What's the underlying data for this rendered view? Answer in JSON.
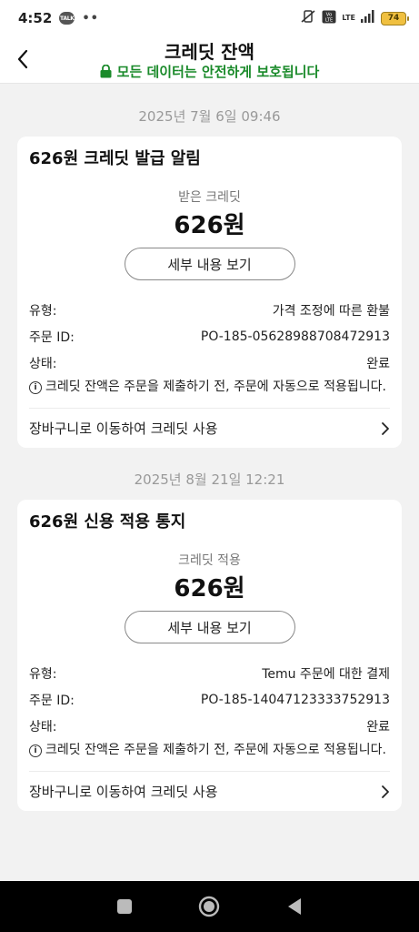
{
  "status_bar": {
    "time": "4:52",
    "talk_badge": "TALK",
    "dots": "••",
    "lte": "LTE",
    "battery": "74"
  },
  "header": {
    "title": "크레딧 잔액",
    "subtitle": "모든 데이터는 안전하게 보호됩니다",
    "accent_color": "#1a8a2a"
  },
  "icons": {
    "back": "chevron-left-icon",
    "lock": "lock-icon",
    "info": "info-circle-icon",
    "chevron": "chevron-right-icon"
  },
  "cards": [
    {
      "date": "2025년 7월 6일 09:46",
      "title": "626원 크레딧 발급 알림",
      "amount_label": "받은 크레딧",
      "amount": "626원",
      "details_button": "세부 내용 보기",
      "rows": [
        {
          "label": "유형:",
          "value": "가격 조정에 따른 환불"
        },
        {
          "label": "주문 ID:",
          "value": "PO-185-05628988708472913"
        },
        {
          "label": "상태:",
          "value": "완료"
        }
      ],
      "notice_icon_text": "i",
      "notice": "크레딧 잔액은 주문을 제출하기 전, 주문에 자동으로 적용됩니다.",
      "cart_link": "장바구니로 이동하여 크레딧 사용"
    },
    {
      "date": "2025년 8월 21일 12:21",
      "title": "626원 신용 적용 통지",
      "amount_label": "크레딧 적용",
      "amount": "626원",
      "details_button": "세부 내용 보기",
      "rows": [
        {
          "label": "유형:",
          "value": "Temu 주문에 대한 결제"
        },
        {
          "label": "주문 ID:",
          "value": "PO-185-14047123333752913"
        },
        {
          "label": "상태:",
          "value": "완료"
        }
      ],
      "notice_icon_text": "i",
      "notice": "크레딧 잔액은 주문을 제출하기 전, 주문에 자동으로 적용됩니다.",
      "cart_link": "장바구니로 이동하여 크레딧 사용"
    }
  ]
}
